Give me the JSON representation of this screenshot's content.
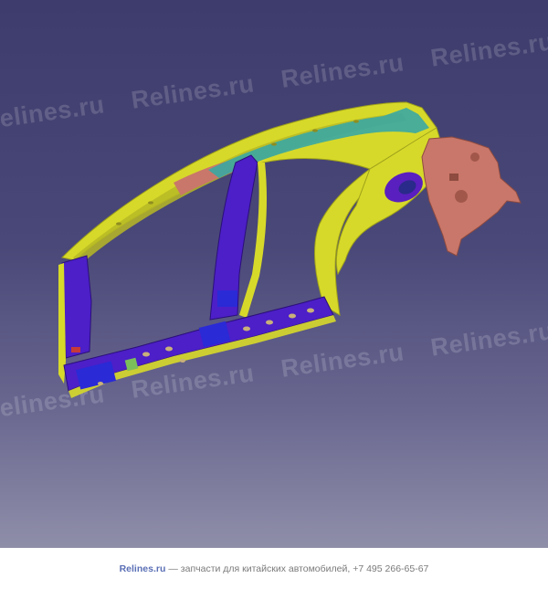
{
  "watermark": {
    "text": "Relines.ru"
  },
  "footer": {
    "brand": "Relines.ru",
    "tagline": " — запчасти для китайских автомобилей, +7 495 266-65-67"
  },
  "colors": {
    "background_top": "#3e3c6c",
    "background_bottom": "#8f8ea9",
    "frame_yellow": "#d8da2a",
    "frame_purple": "#4c1fc8",
    "frame_salmon": "#c9776a",
    "frame_teal": "#3aa7a3",
    "frame_blue": "#2a2ad6"
  },
  "icons": [
    "car-body-side-panel-model"
  ]
}
